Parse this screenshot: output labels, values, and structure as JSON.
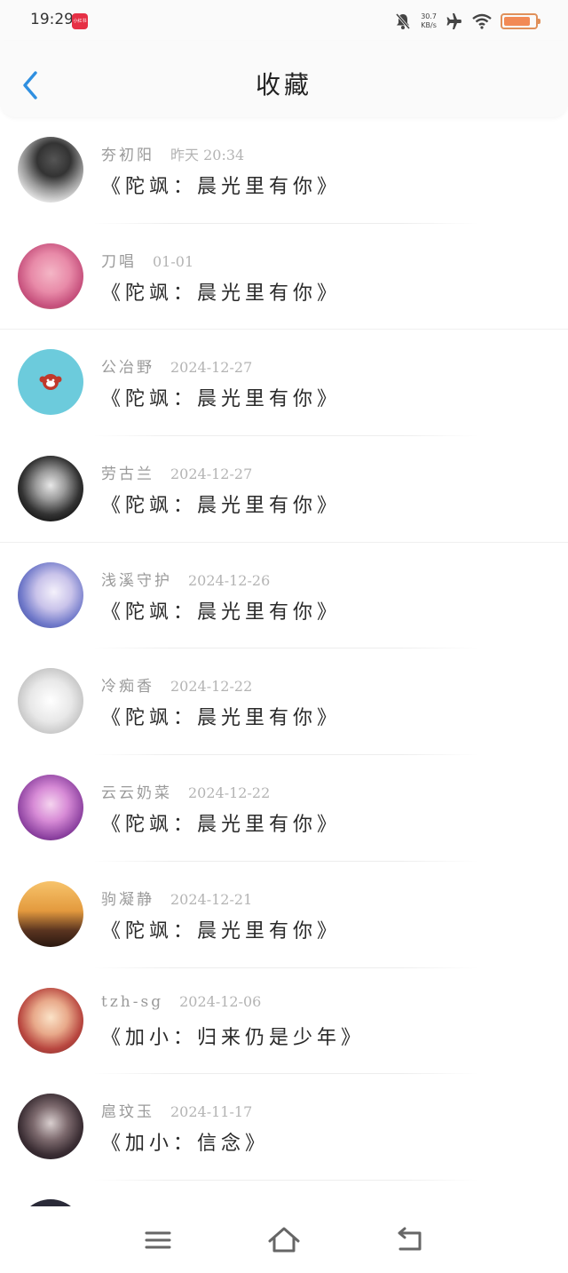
{
  "status_bar": {
    "time": "19:29",
    "app_badge": "小红书",
    "net_speed_value": "30.7",
    "net_speed_unit": "KB/s",
    "battery_level": 0.85,
    "icons": [
      "mute-bell-icon",
      "airplane-icon",
      "wifi-icon",
      "battery-icon"
    ]
  },
  "header": {
    "title": "收藏",
    "back_icon": "chevron-left-icon",
    "accent_color": "#2f8fe0"
  },
  "items": [
    {
      "name": "夯初阳",
      "time": "昨天 20:34",
      "title": "《陀飒：晨光里有你》"
    },
    {
      "name": "刀唱",
      "time": "01-01",
      "title": "《陀飒：晨光里有你》"
    },
    {
      "name": "公冶野",
      "time": "2024-12-27",
      "title": "《陀飒：晨光里有你》"
    },
    {
      "name": "劳古兰",
      "time": "2024-12-27",
      "title": "《陀飒：晨光里有你》"
    },
    {
      "name": "浅溪守护",
      "time": "2024-12-26",
      "title": "《陀飒：晨光里有你》"
    },
    {
      "name": "冷痴香",
      "time": "2024-12-22",
      "title": "《陀飒：晨光里有你》"
    },
    {
      "name": "云云奶菜",
      "time": "2024-12-22",
      "title": "《陀飒：晨光里有你》"
    },
    {
      "name": "驹凝静",
      "time": "2024-12-21",
      "title": "《陀飒：晨光里有你》"
    },
    {
      "name": "tzh-sg",
      "time": "2024-12-06",
      "title": "《加小：归来仍是少年》"
    },
    {
      "name": "扈玟玉",
      "time": "2024-11-17",
      "title": "《加小：信念》"
    }
  ],
  "nav": {
    "icons": [
      "menu-icon",
      "home-icon",
      "back-icon"
    ]
  }
}
